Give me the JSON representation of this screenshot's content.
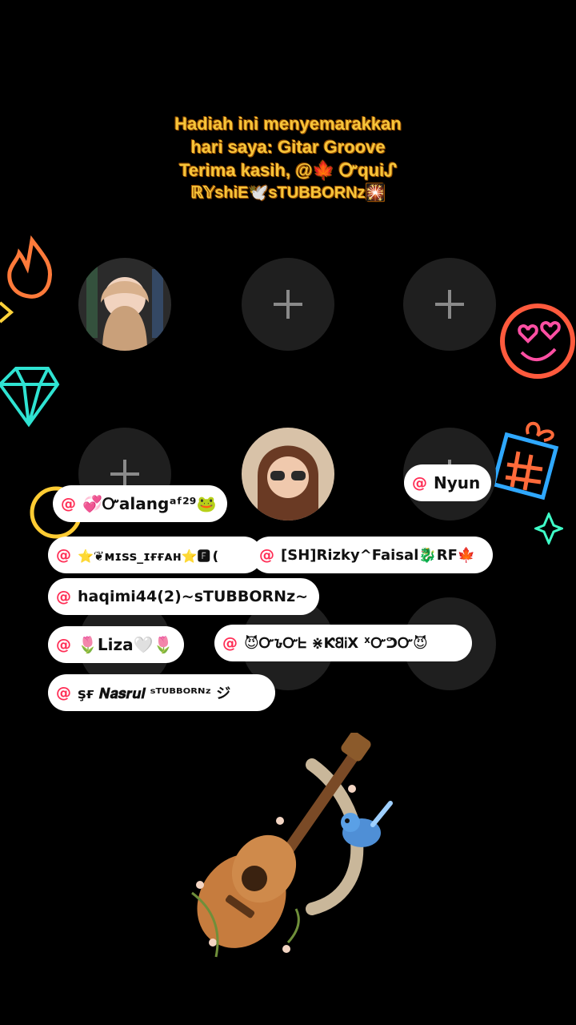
{
  "banner": {
    "line1": "Hadiah ini menyemarakkan",
    "line2": "hari saya: Gitar Groove",
    "line3": "Terima kasih, @🍁 Ꮕquiᔑ",
    "line4": "ℝ𝕐shiE🕊️sTUBBORNz🎇"
  },
  "mentions": [
    "💞Ꮕalangᵃᶠ²⁹🐸",
    "Nyun",
    "⭐❦ᴍɪss_ɪғғᴀʜ⭐🅵❪",
    "[SH]Rizky^Faisal🐉RF🍁",
    "haqimi44(2)~sTUBBORNz~",
    "🌷Liza🤍🌷",
    "😈Ꮕ𐒊Ꮕᖶ ⋇Ƙ𐐒ᎥⅩ ᕁᏅᕤᏅ😈",
    "şғ 𝑵𝒂𝒔𝒓𝒖𝒍 ˢᵀᵁᴮᴮᴼᴿᴺᶻ ジ"
  ],
  "at_symbol": "@",
  "colors": {
    "banner": "#f7c53a",
    "mention_at": "#ff2d55",
    "chip_bg": "#ffffff"
  }
}
